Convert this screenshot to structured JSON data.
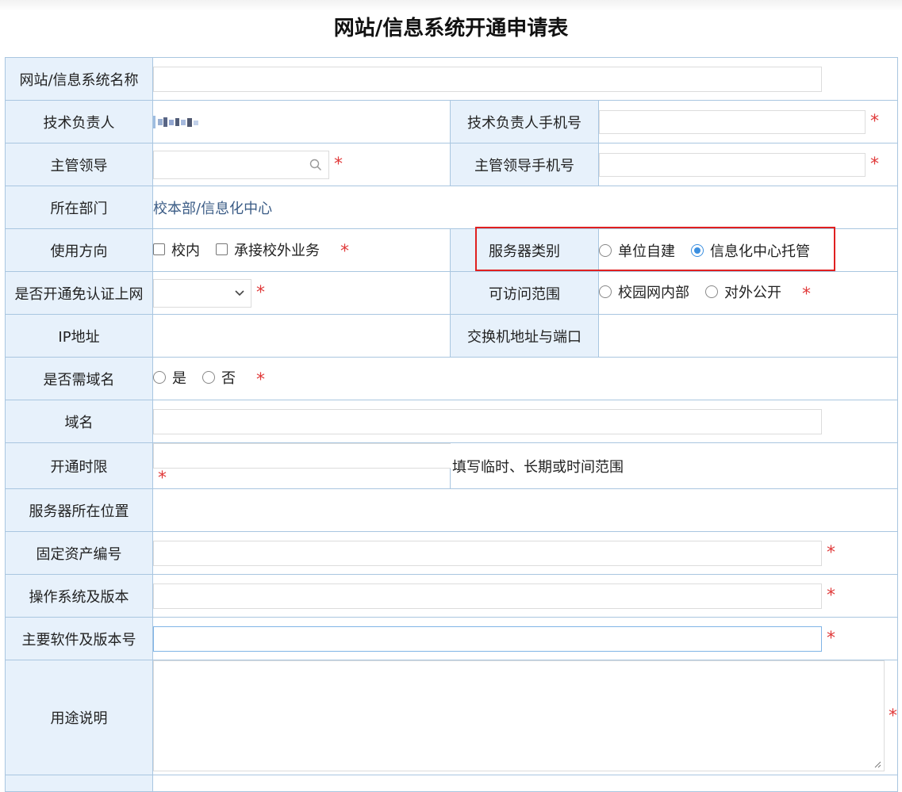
{
  "title": "网站/信息系统开通申请表",
  "rows": {
    "system_name": {
      "label": "网站/信息系统名称",
      "value": ""
    },
    "tech_owner": {
      "label": "技术负责人",
      "value_masked": true
    },
    "tech_phone": {
      "label": "技术负责人手机号",
      "value": ""
    },
    "leader": {
      "label": "主管领导",
      "value": ""
    },
    "leader_phone": {
      "label": "主管领导手机号",
      "value": ""
    },
    "department": {
      "label": "所在部门",
      "value": "校本部/信息化中心"
    },
    "usage": {
      "label": "使用方向",
      "options": [
        "校内",
        "承接校外业务"
      ]
    },
    "server_type": {
      "label": "服务器类别",
      "options": [
        "单位自建",
        "信息化中心托管"
      ],
      "selected": "信息化中心托管"
    },
    "auth_free": {
      "label": "是否开通免认证上网",
      "value": ""
    },
    "access_scope": {
      "label": "可访问范围",
      "options": [
        "校园网内部",
        "对外公开"
      ]
    },
    "ip": {
      "label": "IP地址",
      "value": ""
    },
    "switch": {
      "label": "交换机地址与端口",
      "value": ""
    },
    "need_domain": {
      "label": "是否需域名",
      "options": [
        "是",
        "否"
      ]
    },
    "domain": {
      "label": "域名",
      "value": ""
    },
    "duration": {
      "label": "开通时限",
      "value": "",
      "hint": "填写临时、长期或时间范围"
    },
    "server_location": {
      "label": "服务器所在位置",
      "value": ""
    },
    "asset_no": {
      "label": "固定资产编号",
      "value": ""
    },
    "os": {
      "label": "操作系统及版本",
      "value": ""
    },
    "software": {
      "label": "主要软件及版本号",
      "value": ""
    },
    "purpose": {
      "label": "用途说明",
      "value": ""
    }
  },
  "required_mark": "*",
  "colors": {
    "label_bg": "#e7f1fb",
    "border": "#a9c6e0",
    "required": "#e03a3a",
    "highlight": "#e02020",
    "radio_on": "#3b8fe0"
  },
  "icons": {
    "search": "search-icon",
    "dropdown": "chevron-down-icon"
  }
}
